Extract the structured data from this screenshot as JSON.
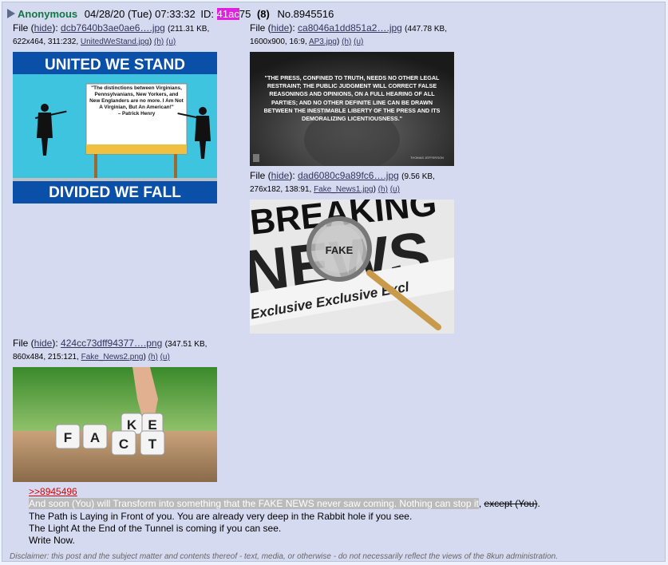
{
  "post": {
    "name": "Anonymous",
    "date": "04/28/20 (Tue) 07:33:32",
    "id_label": "ID:",
    "id_highlight": "41ac",
    "id_rest": "75",
    "reply_count": "(8)",
    "post_number": "No.8945516"
  },
  "files": [
    {
      "label": "File (",
      "hide": "hide",
      "sep": "):",
      "filename": "dcb7640b3ae0ae6….jpg",
      "meta_a": "(211.31 KB,",
      "meta_b": "622x464, 311:232,",
      "original": "UnitedWeStand.jpg",
      "h": "(h)",
      "u": "(u)",
      "image": {
        "top_text": "UNITED WE STAND",
        "bottom_text": "DIVIDED WE FALL",
        "quote": "\"The distinctions between Virginians, Pennsylvanians, New Yorkers, and New Englanders are no more. I Am Not A Virginian, But An American!\"",
        "attribution": "– Patrick Henry"
      }
    },
    {
      "label": "File (",
      "hide": "hide",
      "sep": "):",
      "filename": "ca8046a1dd851a2….jpg",
      "meta_a": "(447.78 KB,",
      "meta_b": "1600x900, 16:9,",
      "original": "AP3.jpg",
      "h": "(h)",
      "u": "(u)",
      "image": {
        "quote": "\"THE PRESS, CONFINED TO TRUTH, NEEDS NO OTHER LEGAL RESTRAINT; THE PUBLIC JUDGMENT WILL CORRECT FALSE REASONINGS AND OPINIONS, ON A FULL HEARING OF ALL PARTIES; AND NO OTHER DEFINITE LINE CAN BE DRAWN BETWEEN THE INESTIMABLE LIBERTY OF THE PRESS AND ITS DEMORALIZING LICENTIOUSNESS.\"",
        "author": "THOMAS JEFFERSON"
      }
    },
    {
      "label": "File (",
      "hide": "hide",
      "sep": "):",
      "filename": "dad6080c9a89fc6….jpg",
      "meta_a": "(9.56 KB,",
      "meta_b": "276x182, 138:91,",
      "original": "Fake_News1.jpg",
      "h": "(h)",
      "u": "(u)",
      "image": {
        "headline": "BREAKING",
        "headline2": "NEWS",
        "lens_text": "FAKE",
        "band_text": "Exclusive Exclusive Excl"
      }
    },
    {
      "label": "File (",
      "hide": "hide",
      "sep": "):",
      "filename": "424cc73dff94377….png",
      "meta_a": "(347.51 KB,",
      "meta_b": "860x484, 215:121,",
      "original": "Fake_News2.png",
      "h": "(h)",
      "u": "(u)",
      "image": {
        "row_top": [
          "K",
          "E"
        ],
        "row_bottom": [
          "F",
          "A",
          "C",
          "T"
        ]
      }
    }
  ],
  "body": {
    "quote_link": ">>8945496",
    "line1_highlight": "And soon (You) will Transform into something that the FAKE NEWS never saw coming. Nothing can stop it",
    "line1_comma": ",",
    "line1_strike": "except (You)",
    "line1_end": ".",
    "line2": "The Path is Laying in Front of you. You are already very deep in the Rabbit hole if you see.",
    "line3": "The Light At the End of the Tunnel is coming if you can see.",
    "line4": "Write Now."
  },
  "disclaimer": "Disclaimer: this post and the subject matter and contents thereof - text, media, or otherwise - do not necessarily reflect the views of the 8kun administration.",
  "colors": {
    "post_bg": "#d6daf0",
    "name": "#117743",
    "id_highlight": "#e020e0",
    "quote_link": "#dd0000",
    "link": "#34345c"
  }
}
